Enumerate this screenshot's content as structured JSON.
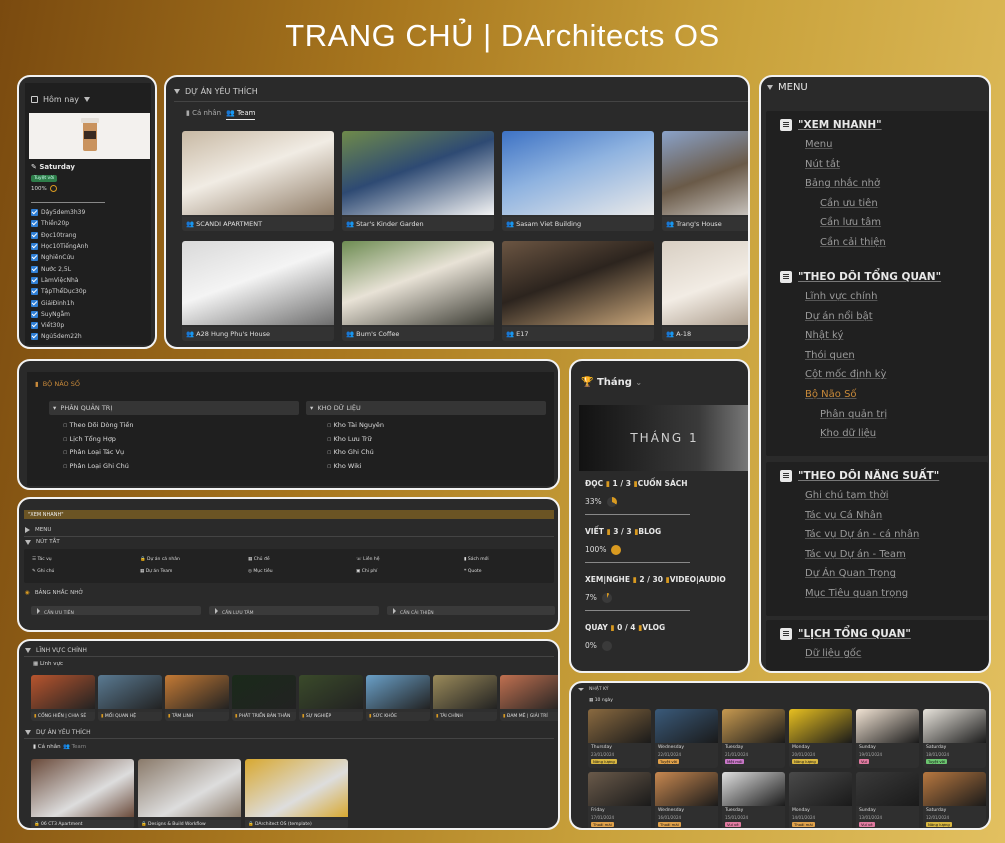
{
  "page_title": "TRANG CHỦ | DArchitects OS",
  "today": {
    "header_small": "",
    "selector": "Hôm nay",
    "day": "Saturday",
    "badge": "Tuyệt vời",
    "percent": "100%",
    "todos": [
      "Dậy5dem3h39",
      "Thiền20p",
      "Đọc10trang",
      "Học10TiếngAnh",
      "NghiênCứu",
      "Nước 2,5L",
      "LàmViệcNhà",
      "TậpThểDục30p",
      "GiảiĐinh1h",
      "SuyNgẫm",
      "Viết30p",
      "Ngủ5dem22h"
    ]
  },
  "favorites": {
    "title": "DỰ ÁN YÊU THÍCH",
    "tabs": [
      "Cá nhân",
      "Team"
    ],
    "projects": [
      "SCANDI APARTMENT",
      "Star's Kinder Garden",
      "Sasam Viet Building",
      "Trang's House",
      "A28 Hung Phu's House",
      "Bum's Coffee",
      "E17",
      "A-18"
    ]
  },
  "menu": {
    "title": "MENU",
    "sections": [
      {
        "head": "\"XEM NHANH\"",
        "items": [
          [
            "Menu",
            0
          ],
          [
            "Nút tắt",
            0
          ],
          [
            "Bảng nhắc nhở",
            0
          ],
          [
            "Cần ưu tiên",
            1
          ],
          [
            "Cần lưu tâm",
            1
          ],
          [
            "Cần cải thiện",
            1
          ]
        ]
      },
      {
        "head": "\"THEO DÕI TỔNG QUAN\"",
        "items": [
          [
            "Lĩnh vực chính",
            0
          ],
          [
            "Dự án nổi bật",
            0
          ],
          [
            "Nhật ký",
            0
          ],
          [
            "Thói quen",
            0
          ],
          [
            "Cột mốc định kỳ",
            0
          ],
          [
            "Bộ Não Số",
            0
          ],
          [
            "Phân quản trị",
            1
          ],
          [
            "Kho dữ liệu",
            1
          ]
        ]
      },
      {
        "head": "\"THEO DÕI NĂNG SUẤT\"",
        "items": [
          [
            "Ghi chú tạm thời",
            0
          ],
          [
            "Tác vụ Cá Nhân",
            0
          ],
          [
            "Tác vụ Dự án - cá nhân",
            0
          ],
          [
            "Tác vụ Dự án - Team",
            0
          ],
          [
            "Dự Án Quan Trọng",
            0
          ],
          [
            "Mục Tiêu quan trọng",
            0
          ]
        ]
      },
      {
        "head": "\"LỊCH TỔNG QUAN\"",
        "items": [
          [
            "Dữ liệu gốc",
            0
          ]
        ]
      }
    ]
  },
  "brain": {
    "title": "BỘ NÃO SỐ",
    "left_title": "PHÂN QUẢN TRỊ",
    "left_items": [
      "Theo Dõi Dòng Tiền",
      "Lịch Tổng Hợp",
      "Phân Loại Tác Vụ",
      "Phân Loại Ghi Chú"
    ],
    "right_title": "KHO DỮ LIỆU",
    "right_items": [
      "Kho Tài Nguyên",
      "Kho Lưu Trữ",
      "Kho Ghi Chú",
      "Kho Wiki"
    ]
  },
  "month": {
    "selector": "Tháng",
    "banner": "THÁNG 1",
    "stats": [
      {
        "label": "ĐỌC",
        "count": "1 / 3",
        "unit": "CUỐN SÁCH",
        "pct": "33%",
        "value": 0.33
      },
      {
        "label": "VIẾT",
        "count": "3 / 3",
        "unit": "BLOG",
        "pct": "100%",
        "value": 1.0
      },
      {
        "label": "XEM|NGHE",
        "count": "2 / 30",
        "unit": "VIDEO|AUDIO",
        "pct": "7%",
        "value": 0.07
      },
      {
        "label": "QUAY",
        "count": "0 / 4",
        "unit": "VLOG",
        "pct": "0%",
        "value": 0
      }
    ]
  },
  "quick": {
    "title": "\"XEM NHANH\"",
    "menu": "MENU",
    "shortcuts_title": "NÚT TẮT",
    "shortcuts": [
      "Tác vụ",
      "Dự án cá nhân",
      "Chủ đề",
      "Liên hệ",
      "Sách mới",
      "Ghi chú",
      "Dự án Team",
      "Mục tiêu",
      "Chi phí",
      "Quote"
    ],
    "reminder_title": "BẢNG NHẮC NHỞ",
    "reminders": [
      "CẦN ƯU TIÊN",
      "CẦN LƯU TÂM",
      "CẦN CẢI THIỆN"
    ]
  },
  "areas": {
    "title": "LĨNH VỰC CHÍNH",
    "tab": "Lĩnh vực",
    "items": [
      "CỐNG HIẾN | CHIA SẺ",
      "MỐI QUAN HỆ",
      "TÂM LINH",
      "PHÁT TRIỂN BẢN THÂN",
      "SỰ NGHIỆP",
      "SỨC KHỎE",
      "TÀI CHÍNH",
      "ĐAM MÊ | GIẢI TRÍ"
    ],
    "fav_title": "DỰ ÁN YÊU THÍCH",
    "fav_tabs": [
      "Cá nhân",
      "Team"
    ],
    "fav_items": [
      "06 CT3 Apartment",
      "Designs & Build Workflow",
      "DArchitect OS (template)"
    ]
  },
  "diary": {
    "title": "NHẬT KÝ",
    "tab": "10 ngày",
    "entries": [
      {
        "day": "Thursday",
        "date": "23/01/2024",
        "tag": "Năng lượng",
        "tagc": "#d8b640"
      },
      {
        "day": "Wednesday",
        "date": "22/01/2024",
        "tag": "Tuyệt vời",
        "tagc": "#e0a14a"
      },
      {
        "day": "Tuesday",
        "date": "21/01/2024",
        "tag": "Mệt mỏi",
        "tagc": "#c977c8"
      },
      {
        "day": "Monday",
        "date": "20/01/2024",
        "tag": "Năng lượng",
        "tagc": "#d8b640"
      },
      {
        "day": "Sunday",
        "date": "19/01/2024",
        "tag": "Vui",
        "tagc": "#e07aa0"
      },
      {
        "day": "Saturday",
        "date": "18/01/2024",
        "tag": "Tuyệt vời",
        "tagc": "#6bc46f"
      },
      {
        "day": "Friday",
        "date": "17/01/2024",
        "tag": "Thoải mái",
        "tagc": "#e0a14a"
      },
      {
        "day": "Wednesday",
        "date": "16/01/2024",
        "tag": "Thoải mái",
        "tagc": "#e0a14a"
      },
      {
        "day": "Tuesday",
        "date": "15/01/2024",
        "tag": "Vui vẻ",
        "tagc": "#e07aa0"
      },
      {
        "day": "Monday",
        "date": "14/01/2024",
        "tag": "Thoải mái",
        "tagc": "#e0a14a"
      },
      {
        "day": "Sunday",
        "date": "13/01/2024",
        "tag": "Vui vẻ",
        "tagc": "#e07aa0"
      },
      {
        "day": "Saturday",
        "date": "12/01/2024",
        "tag": "Năng lượng",
        "tagc": "#d8b640"
      }
    ]
  },
  "colors": {
    "accent": "#d99a20",
    "link": "#c98a3a",
    "checkbox": "#2f7fd6"
  }
}
